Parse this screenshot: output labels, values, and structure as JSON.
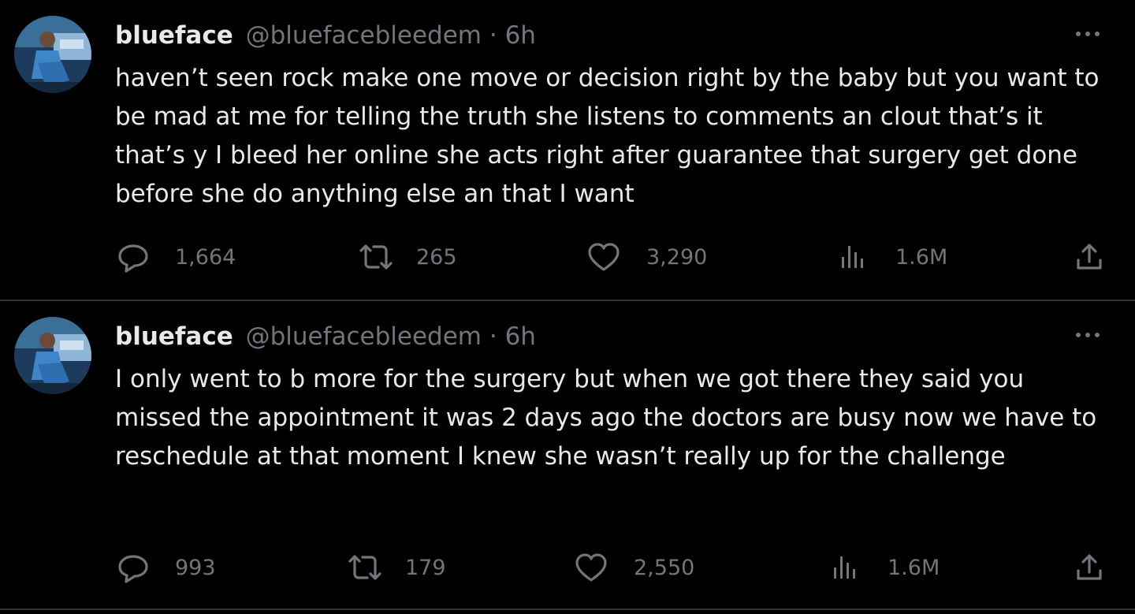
{
  "tweets": [
    {
      "name": "blueface",
      "handle": "@bluefacebleedem",
      "separator": "·",
      "time": "6h",
      "text": "haven’t seen rock make one move or decision right by the baby but you want to be mad at me for telling the truth she listens to comments an clout that’s it that’s y I bleed her online she acts right after guarantee that surgery get done before she do anything else an that I want",
      "replies": "1,664",
      "reposts": "265",
      "likes": "3,290",
      "views": "1.6M"
    },
    {
      "name": "blueface",
      "handle": "@bluefacebleedem",
      "separator": "·",
      "time": "6h",
      "text": "I only went to b more for the surgery but when we got there they said you missed the appointment it was 2 days ago the doctors are busy now we have to reschedule at that moment I knew she wasn’t really up for the challenge",
      "replies": "993",
      "reposts": "179",
      "likes": "2,550",
      "views": "1.6M"
    }
  ],
  "icons": {
    "reply": "reply-icon",
    "repost": "repost-icon",
    "like": "heart-icon",
    "views": "views-icon",
    "share": "share-icon",
    "more": "more-icon"
  },
  "colors": {
    "background": "#000000",
    "text": "#e7e9ea",
    "muted": "#71767b",
    "divider": "#2f3336"
  }
}
